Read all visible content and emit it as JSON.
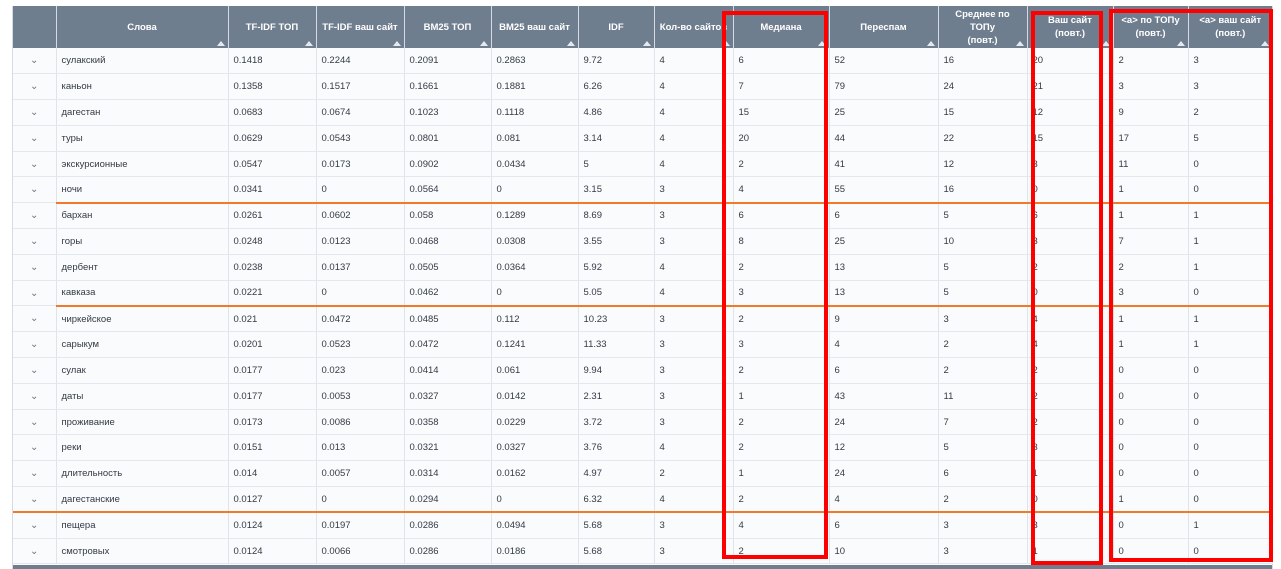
{
  "table": {
    "columns": [
      {
        "key": "expand",
        "label": ""
      },
      {
        "key": "word",
        "label": "Слова"
      },
      {
        "key": "tfidf_top",
        "label": "TF-IDF ТОП"
      },
      {
        "key": "tfidf_site",
        "label": "TF-IDF ваш сайт"
      },
      {
        "key": "bm25_top",
        "label": "BM25 ТОП"
      },
      {
        "key": "bm25_site",
        "label": "BM25 ваш сайт"
      },
      {
        "key": "idf",
        "label": "IDF"
      },
      {
        "key": "sites",
        "label": "Кол-во сайтов"
      },
      {
        "key": "median",
        "label": "Медиана"
      },
      {
        "key": "overspam",
        "label": "Переспам"
      },
      {
        "key": "avg_top",
        "label": "Среднее по ТОПу\n(повт.)"
      },
      {
        "key": "your_site",
        "label": "Ваш сайт\n(повт.)"
      },
      {
        "key": "a_top",
        "label": "<a> по ТОПу\n(повт.)"
      },
      {
        "key": "a_site",
        "label": "<a> ваш сайт\n(повт.)"
      }
    ],
    "expand_icon": "chevron-down-icon",
    "expand_glyph": "⌄",
    "rows": [
      [
        "сулакский",
        "0.1418",
        "0.2244",
        "0.2091",
        "0.2863",
        "9.72",
        "4",
        "6",
        "52",
        "16",
        "20",
        "2",
        "3"
      ],
      [
        "каньон",
        "0.1358",
        "0.1517",
        "0.1661",
        "0.1881",
        "6.26",
        "4",
        "7",
        "79",
        "24",
        "21",
        "3",
        "3"
      ],
      [
        "дагестан",
        "0.0683",
        "0.0674",
        "0.1023",
        "0.1118",
        "4.86",
        "4",
        "15",
        "25",
        "15",
        "12",
        "9",
        "2"
      ],
      [
        "туры",
        "0.0629",
        "0.0543",
        "0.0801",
        "0.081",
        "3.14",
        "4",
        "20",
        "44",
        "22",
        "15",
        "17",
        "5"
      ],
      [
        "экскурсионные",
        "0.0547",
        "0.0173",
        "0.0902",
        "0.0434",
        "5",
        "4",
        "2",
        "41",
        "12",
        "3",
        "11",
        "0"
      ],
      [
        "ночи",
        "0.0341",
        "0",
        "0.0564",
        "0",
        "3.15",
        "3",
        "4",
        "55",
        "16",
        "0",
        "1",
        "0"
      ],
      [
        "бархан",
        "0.0261",
        "0.0602",
        "0.058",
        "0.1289",
        "8.69",
        "3",
        "6",
        "6",
        "5",
        "6",
        "1",
        "1"
      ],
      [
        "горы",
        "0.0248",
        "0.0123",
        "0.0468",
        "0.0308",
        "3.55",
        "3",
        "8",
        "25",
        "10",
        "3",
        "7",
        "1"
      ],
      [
        "дербент",
        "0.0238",
        "0.0137",
        "0.0505",
        "0.0364",
        "5.92",
        "4",
        "2",
        "13",
        "5",
        "2",
        "2",
        "1"
      ],
      [
        "кавказа",
        "0.0221",
        "0",
        "0.0462",
        "0",
        "5.05",
        "4",
        "3",
        "13",
        "5",
        "0",
        "3",
        "0"
      ],
      [
        "чиркейское",
        "0.021",
        "0.0472",
        "0.0485",
        "0.112",
        "10.23",
        "3",
        "2",
        "9",
        "3",
        "4",
        "1",
        "1"
      ],
      [
        "сарыкум",
        "0.0201",
        "0.0523",
        "0.0472",
        "0.1241",
        "11.33",
        "3",
        "3",
        "4",
        "2",
        "4",
        "1",
        "1"
      ],
      [
        "сулак",
        "0.0177",
        "0.023",
        "0.0414",
        "0.061",
        "9.94",
        "3",
        "2",
        "6",
        "2",
        "2",
        "0",
        "0"
      ],
      [
        "даты",
        "0.0177",
        "0.0053",
        "0.0327",
        "0.0142",
        "2.31",
        "3",
        "1",
        "43",
        "11",
        "2",
        "0",
        "0"
      ],
      [
        "проживание",
        "0.0173",
        "0.0086",
        "0.0358",
        "0.0229",
        "3.72",
        "3",
        "2",
        "24",
        "7",
        "2",
        "0",
        "0"
      ],
      [
        "реки",
        "0.0151",
        "0.013",
        "0.0321",
        "0.0327",
        "3.76",
        "4",
        "2",
        "12",
        "5",
        "3",
        "0",
        "0"
      ],
      [
        "длительность",
        "0.014",
        "0.0057",
        "0.0314",
        "0.0162",
        "4.97",
        "2",
        "1",
        "24",
        "6",
        "1",
        "0",
        "0"
      ],
      [
        "дагестанские",
        "0.0127",
        "0",
        "0.0294",
        "0",
        "6.32",
        "4",
        "2",
        "4",
        "2",
        "0",
        "1",
        "0"
      ],
      [
        "пещера",
        "0.0124",
        "0.0197",
        "0.0286",
        "0.0494",
        "5.68",
        "3",
        "4",
        "6",
        "3",
        "3",
        "0",
        "1"
      ],
      [
        "смотровых",
        "0.0124",
        "0.0066",
        "0.0286",
        "0.0186",
        "5.68",
        "3",
        "2",
        "10",
        "3",
        "1",
        "0",
        "0"
      ]
    ],
    "separator_after_rows": [
      5,
      9,
      17
    ],
    "separator_color": "#f07a2a"
  },
  "highlight_color": "#ff0000",
  "header_color": "#6f7e8f"
}
